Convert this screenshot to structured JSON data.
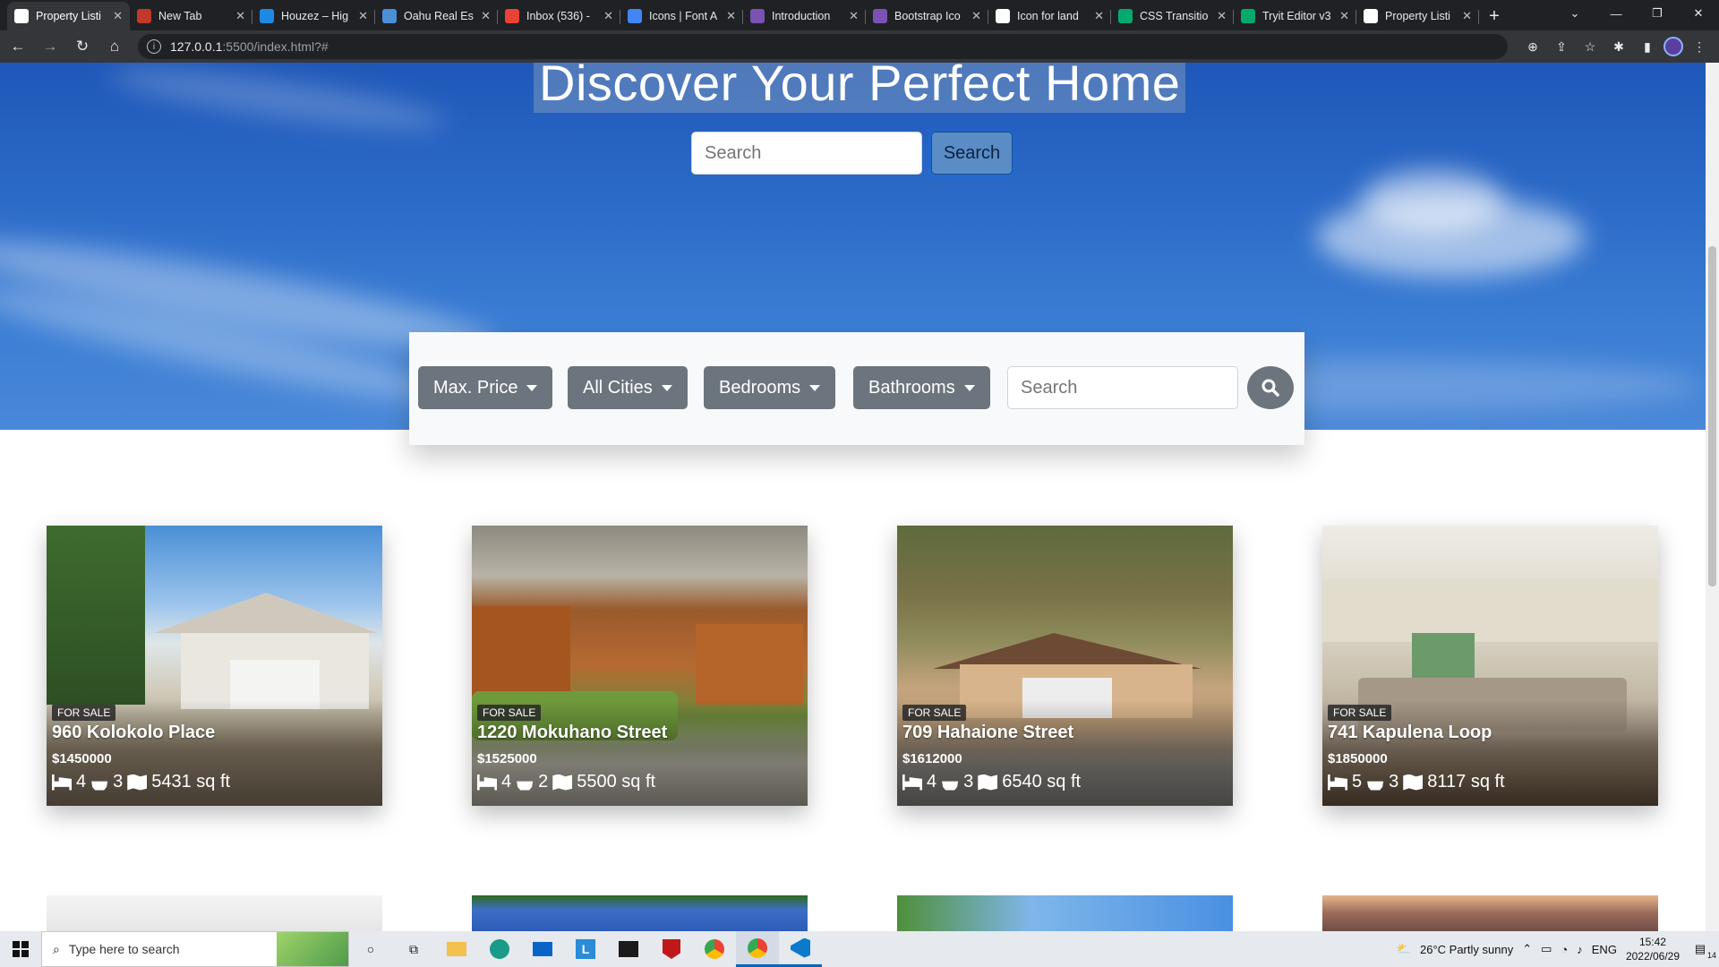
{
  "browser": {
    "tabs": [
      {
        "title": "Property Listi",
        "active": true,
        "icon": "globe-icon",
        "color": "#ffffff"
      },
      {
        "title": "New Tab",
        "icon": "newtab-icon",
        "color": "#c0392b"
      },
      {
        "title": "Houzez – Hig",
        "icon": "houzez-icon",
        "color": "#1e88e5"
      },
      {
        "title": "Oahu Real Est",
        "icon": "oahu-icon",
        "color": "#4a90d9"
      },
      {
        "title": "Inbox (536) -",
        "icon": "gmail-icon",
        "color": "#ea4335"
      },
      {
        "title": "Icons | Font A",
        "icon": "flag-icon",
        "color": "#4285f4"
      },
      {
        "title": "Introduction",
        "icon": "bootstrap-icon",
        "color": "#7952b3"
      },
      {
        "title": "Bootstrap Ico",
        "icon": "bootstrap-icon",
        "color": "#7952b3"
      },
      {
        "title": "Icon for land",
        "icon": "google-icon",
        "color": "#ffffff"
      },
      {
        "title": "CSS Transitio",
        "icon": "w3schools-icon",
        "color": "#04aa6d"
      },
      {
        "title": "Tryit Editor v3",
        "icon": "w3schools-icon",
        "color": "#04aa6d"
      },
      {
        "title": "Property Listi",
        "icon": "globe-icon",
        "color": "#ffffff"
      }
    ],
    "url": {
      "host": "127.0.0.1",
      "path": ":5500/index.html?#"
    }
  },
  "hero": {
    "title": "Discover Your Perfect Home",
    "search_placeholder": "Search",
    "search_button": "Search"
  },
  "filters": {
    "max_price": "Max. Price",
    "cities": "All Cities",
    "bedrooms": "Bedrooms",
    "bathrooms": "Bathrooms",
    "search_placeholder": "Search"
  },
  "listings": [
    {
      "status": "FOR SALE",
      "address": "960 Kolokolo Place",
      "price": "$1450000",
      "beds": "4",
      "baths": "3",
      "sqft": "5431 sq ft"
    },
    {
      "status": "FOR SALE",
      "address": "1220 Mokuhano Street",
      "price": "$1525000",
      "beds": "4",
      "baths": "2",
      "sqft": "5500 sq ft"
    },
    {
      "status": "FOR SALE",
      "address": "709 Hahaione Street",
      "price": "$1612000",
      "beds": "4",
      "baths": "3",
      "sqft": "6540 sq ft"
    },
    {
      "status": "FOR SALE",
      "address": "741 Kapulena Loop",
      "price": "$1850000",
      "beds": "5",
      "baths": "3",
      "sqft": "8117 sq ft"
    }
  ],
  "taskbar": {
    "search_placeholder": "Type here to search",
    "weather": "26°C  Partly sunny",
    "language": "ENG",
    "time": "15:42",
    "date": "2022/06/29",
    "notifications": "14"
  }
}
